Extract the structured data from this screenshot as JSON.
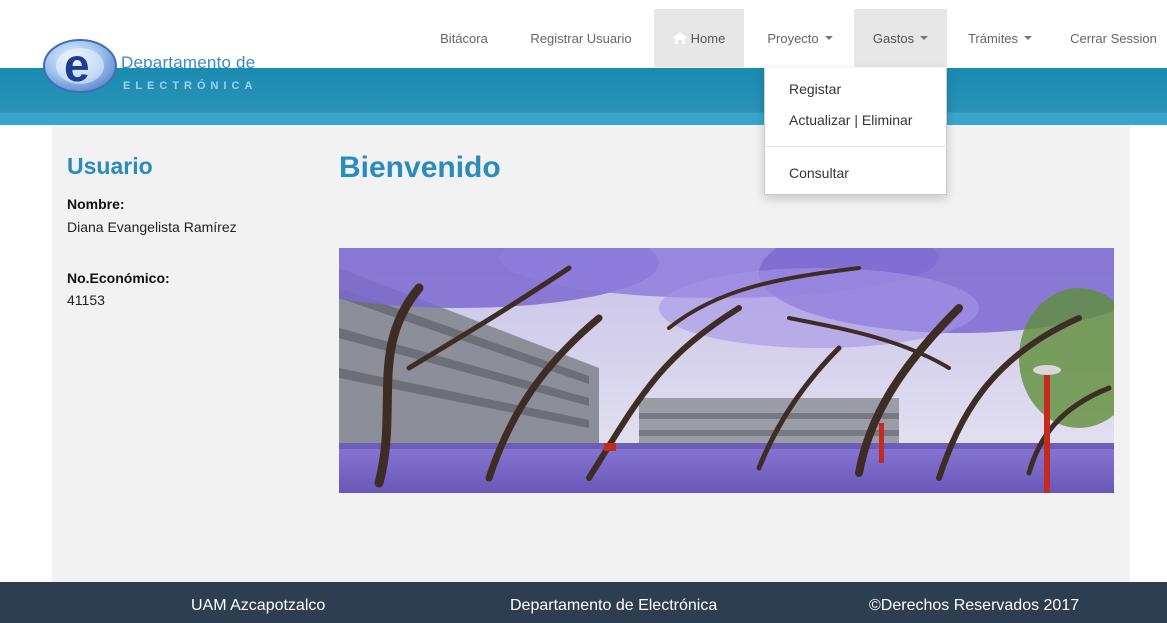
{
  "header": {
    "logo": {
      "line1": "Departamento de",
      "line2": "ELECTRÓNICA",
      "letter": "e"
    },
    "nav": [
      {
        "label": "Bitácora"
      },
      {
        "label": "Registrar Usuario"
      },
      {
        "label": "Home",
        "active": true,
        "icon": "home-icon"
      },
      {
        "label": "Proyecto",
        "dropdown": true
      },
      {
        "label": "Gastos",
        "dropdown": true,
        "open": true
      },
      {
        "label": "Trámites",
        "dropdown": true
      },
      {
        "label": "Cerrar Session"
      }
    ],
    "gastos_menu": [
      "Registar",
      "Actualizar | Eliminar",
      "Consultar"
    ]
  },
  "sidebar": {
    "title": "Usuario",
    "name_label": "Nombre:",
    "name_value": "Diana Evangelista Ramírez",
    "id_label": "No.Económico:",
    "id_value": "41153"
  },
  "main": {
    "heading": "Bienvenido"
  },
  "footer": {
    "left": "UAM Azcapotzalco",
    "center": "Departamento de Electrónica",
    "right": "©Derechos Reservados 2017"
  },
  "colors": {
    "brand_blue": "#2a8bbd",
    "band_blue": "#1a8bb2",
    "footer_bg": "#2c3e50",
    "jacaranda": "#8a7ad9"
  }
}
